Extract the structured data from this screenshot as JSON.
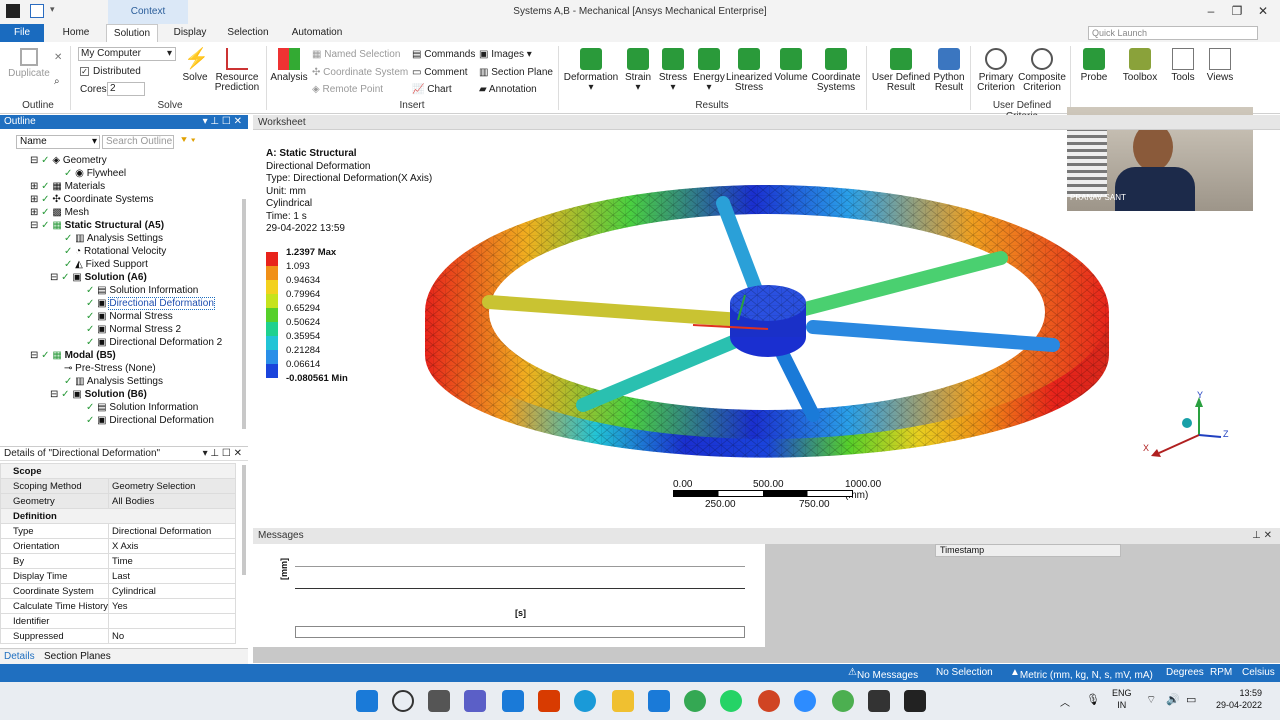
{
  "window": {
    "title": "Systems A,B - Mechanical [Ansys Mechanical Enterprise]",
    "context_tab": "Context"
  },
  "tabs": [
    "File",
    "Home",
    "Solution",
    "Display",
    "Selection",
    "Automation"
  ],
  "quick_launch_placeholder": "Quick Launch",
  "ribbon": {
    "duplicate": "Duplicate",
    "outline_group": "Outline",
    "computer": "My Computer",
    "distributed": "Distributed",
    "cores_label": "Cores",
    "cores_value": "2",
    "solve": "Solve",
    "resource_prediction": "Resource Prediction",
    "solve_group": "Solve",
    "analysis": "Analysis",
    "named_selection": "Named Selection",
    "coordinate_system": "Coordinate System",
    "remote_point": "Remote Point",
    "commands": "Commands",
    "comment": "Comment",
    "chart": "Chart",
    "images": "Images",
    "section_plane": "Section Plane",
    "annotation": "Annotation",
    "insert_group": "Insert",
    "results": [
      "Deformation",
      "Strain",
      "Stress",
      "Energy",
      "Linearized Stress",
      "Volume",
      "Coordinate Systems"
    ],
    "results_group": "Results",
    "udr": [
      "User Defined Result",
      "Python Result"
    ],
    "criteria": [
      "Primary Criterion",
      "Composite Criterion"
    ],
    "udc_group": "User Defined Criteria",
    "tools": [
      "Probe",
      "Toolbox",
      "Tools",
      "Views"
    ]
  },
  "outline": {
    "header": "Outline",
    "name_col": "Name",
    "search_placeholder": "Search Outline",
    "items": [
      "Geometry",
      "Flywheel",
      "Materials",
      "Coordinate Systems",
      "Mesh",
      "Static Structural (A5)",
      "Analysis Settings",
      "Rotational Velocity",
      "Fixed Support",
      "Solution (A6)",
      "Solution Information",
      "Directional Deformation",
      "Normal Stress",
      "Normal Stress 2",
      "Directional Deformation 2",
      "Modal (B5)",
      "Pre-Stress (None)",
      "Analysis Settings",
      "Solution (B6)",
      "Solution Information",
      "Directional Deformation"
    ]
  },
  "details": {
    "header": "Details of \"Directional Deformation\"",
    "rows": [
      {
        "k": "Scope",
        "v": "",
        "sec": true
      },
      {
        "k": "Scoping Method",
        "v": "Geometry Selection",
        "shade": true
      },
      {
        "k": "Geometry",
        "v": "All Bodies",
        "shade": true
      },
      {
        "k": "Definition",
        "v": "",
        "sec": true
      },
      {
        "k": "Type",
        "v": "Directional Deformation"
      },
      {
        "k": "Orientation",
        "v": "X Axis"
      },
      {
        "k": "By",
        "v": "Time"
      },
      {
        "k": "Display Time",
        "v": "Last"
      },
      {
        "k": "Coordinate System",
        "v": "Cylindrical"
      },
      {
        "k": "Calculate Time History",
        "v": "Yes"
      },
      {
        "k": "Identifier",
        "v": ""
      },
      {
        "k": "Suppressed",
        "v": "No"
      }
    ],
    "bottom_tabs": [
      "Details",
      "Section Planes"
    ]
  },
  "worksheet": {
    "tab": "Worksheet",
    "info": [
      "A: Static Structural",
      "Directional Deformation",
      "Type: Directional Deformation(X Axis)",
      "Unit: mm",
      "Cylindrical",
      "Time: 1 s",
      "29-04-2022 13:59"
    ],
    "legend": [
      "1.2397 Max",
      "1.093",
      "0.94634",
      "0.79964",
      "0.65294",
      "0.50624",
      "0.35954",
      "0.21284",
      "0.06614",
      "-0.080561 Min"
    ],
    "legend_colors": [
      "#e8231b",
      "#f09018",
      "#f3d11e",
      "#c6e31d",
      "#56d02a",
      "#1fd18f",
      "#22c4d6",
      "#2a8fe8",
      "#1a44dc",
      "#1a14c8"
    ],
    "scale_top": [
      "0.00",
      "500.00",
      "1000.00 (mm)"
    ],
    "scale_bottom": [
      "250.00",
      "750.00"
    ],
    "axes": {
      "x": "X",
      "y": "Y",
      "z": "Z"
    },
    "presenter": "PRANAV SANT"
  },
  "messages": {
    "header": "Messages",
    "timestamp": "Timestamp",
    "y_label": "[mm]",
    "x_label": "[s]"
  },
  "status": {
    "messages": "No Messages",
    "selection": "No Selection",
    "units": "Metric (mm, kg, N, s, mV, mA)",
    "deg": "Degrees",
    "rpm": "RPM",
    "temp": "Celsius"
  },
  "taskbar": {
    "lang1": "ENG",
    "lang2": "IN",
    "time": "13:59",
    "date": "29-04-2022"
  }
}
